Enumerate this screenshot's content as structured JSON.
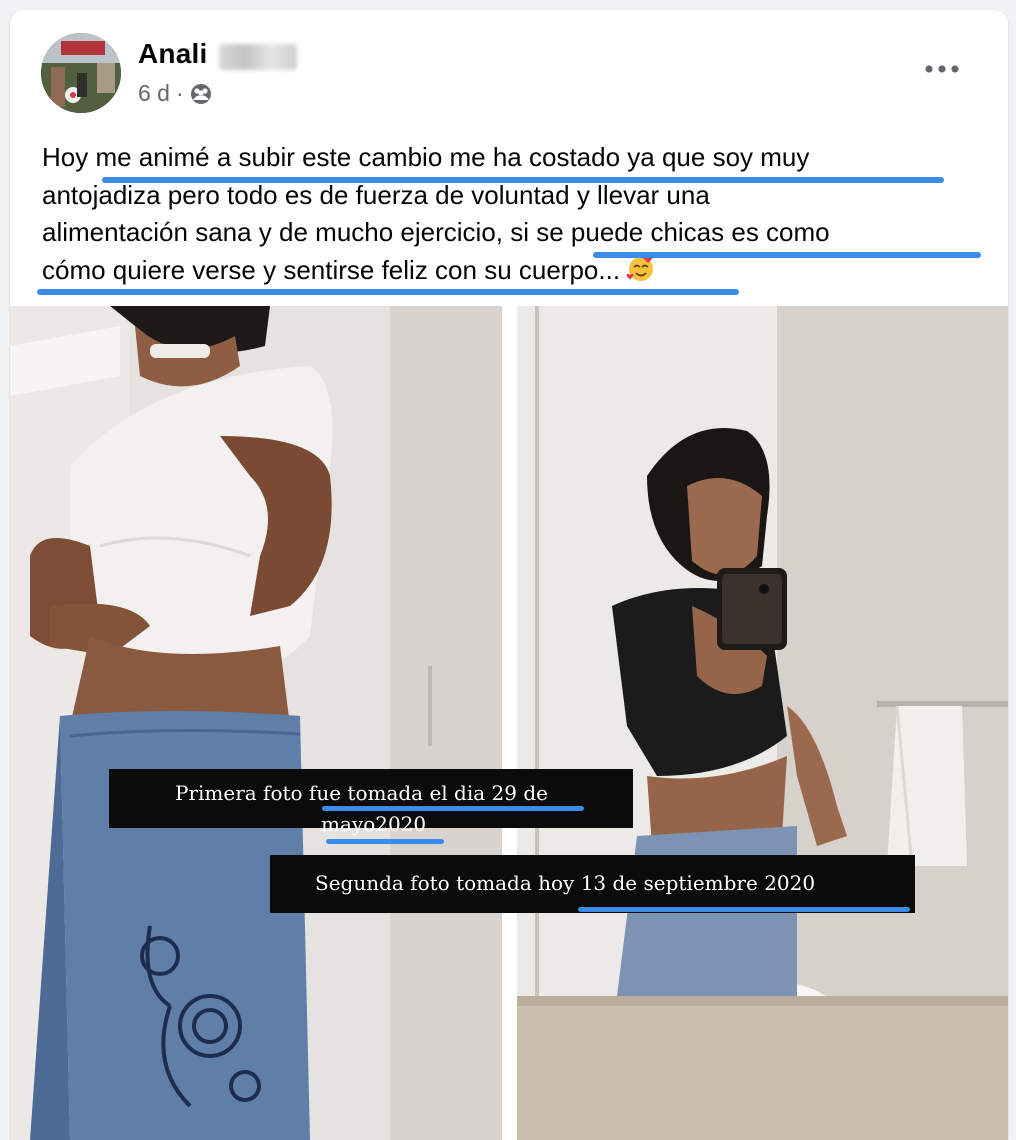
{
  "post": {
    "author_name": "Anali",
    "timestamp": "6 d",
    "separator": "·",
    "audience_icon": "friends-icon",
    "more_icon": "more-options-icon",
    "text_lines": [
      "Hoy me animé a subir este cambio me ha costado ya que soy muy",
      "antojadiza pero todo es de fuerza de voluntad y llevar una",
      "alimentación sana y de mucho ejercicio, si se puede chicas es como",
      "cómo quiere verse y sentirse feliz con su cuerpo..."
    ],
    "emoji": "smiling-face-with-hearts",
    "highlight_color": "#3b8beb"
  },
  "photos": {
    "left_caption_line1": "Primera foto fue tomada el dia 29 de",
    "left_caption_line2": "mayo2020",
    "right_caption": "Segunda foto tomada hoy 13 de septiembre 2020"
  }
}
